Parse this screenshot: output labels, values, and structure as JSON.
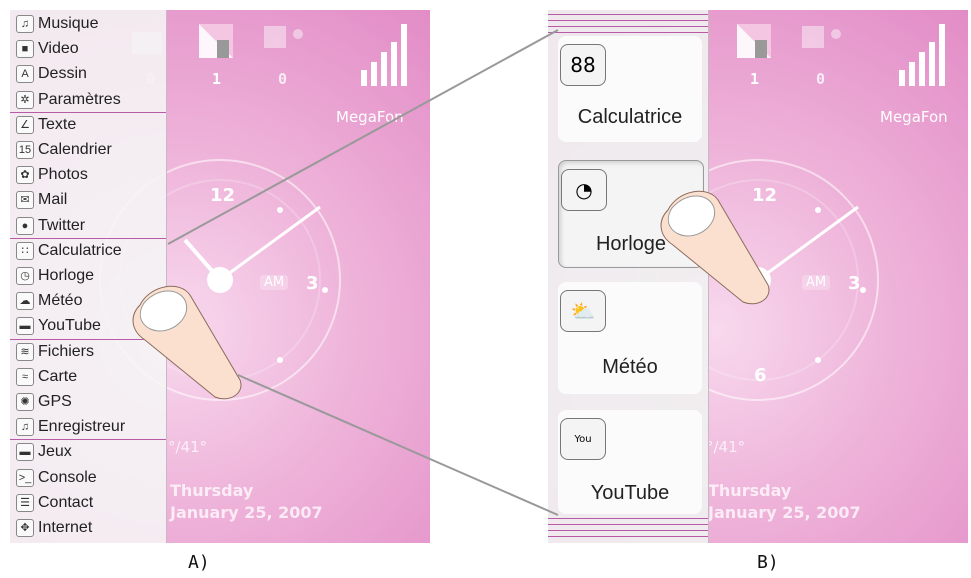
{
  "panel_a": {
    "menu": [
      {
        "label": "Musique",
        "icon": "music-note-icon",
        "glyph": "♫"
      },
      {
        "label": "Video",
        "icon": "video-camera-icon",
        "glyph": "■"
      },
      {
        "label": "Dessin",
        "icon": "draw-compass-icon",
        "glyph": "A"
      },
      {
        "label": "Paramètres",
        "icon": "gear-icon",
        "glyph": "✲"
      },
      {
        "label": "Texte",
        "icon": "pencil-icon",
        "glyph": "∠"
      },
      {
        "label": "Calendrier",
        "icon": "calendar-icon",
        "glyph": "15"
      },
      {
        "label": "Photos",
        "icon": "flower-icon",
        "glyph": "✿"
      },
      {
        "label": "Mail",
        "icon": "envelope-icon",
        "glyph": "✉"
      },
      {
        "label": "Twitter",
        "icon": "speech-bubble-icon",
        "glyph": "●"
      },
      {
        "label": "Calculatrice",
        "icon": "calculator-icon",
        "glyph": "∷"
      },
      {
        "label": "Horloge",
        "icon": "clock-icon",
        "glyph": "◷"
      },
      {
        "label": "Météo",
        "icon": "weather-cloud-icon",
        "glyph": "☁"
      },
      {
        "label": "YouTube",
        "icon": "youtube-icon",
        "glyph": "▬"
      },
      {
        "label": "Fichiers",
        "icon": "files-icon",
        "glyph": "≋"
      },
      {
        "label": "Carte",
        "icon": "map-icon",
        "glyph": "≈"
      },
      {
        "label": "GPS",
        "icon": "gps-icon",
        "glyph": "✺"
      },
      {
        "label": "Enregistreur",
        "icon": "recorder-icon",
        "glyph": "♫"
      },
      {
        "label": "Jeux",
        "icon": "gamepad-icon",
        "glyph": "▬"
      },
      {
        "label": "Console",
        "icon": "console-icon",
        "glyph": ">_"
      },
      {
        "label": "Contact",
        "icon": "contact-card-icon",
        "glyph": "☰"
      },
      {
        "label": "Internet",
        "icon": "globe-icon",
        "glyph": "✥"
      }
    ],
    "caption": "A)"
  },
  "panel_b": {
    "tiles": [
      {
        "label": "Calculatrice",
        "icon": "calculator-icon",
        "glyph": "88"
      },
      {
        "label": "Horloge",
        "icon": "clock-icon",
        "glyph": "◔"
      },
      {
        "label": "Météo",
        "icon": "weather-cloud-icon",
        "glyph": "⛅"
      },
      {
        "label": "YouTube",
        "icon": "youtube-icon",
        "glyph": "You"
      }
    ],
    "caption": "B)"
  },
  "home": {
    "status_counts": [
      "0",
      "1",
      "0"
    ],
    "carrier": "MegaFon",
    "clock_numbers": {
      "twelve": "12",
      "three": "3",
      "six": "6"
    },
    "ampm": "AM",
    "temperature": "°/41°",
    "day": "Thursday",
    "date": "January 25, 2007"
  },
  "colors": {
    "accent": "#b85aa6",
    "background_pink": "#eeb2d9"
  }
}
